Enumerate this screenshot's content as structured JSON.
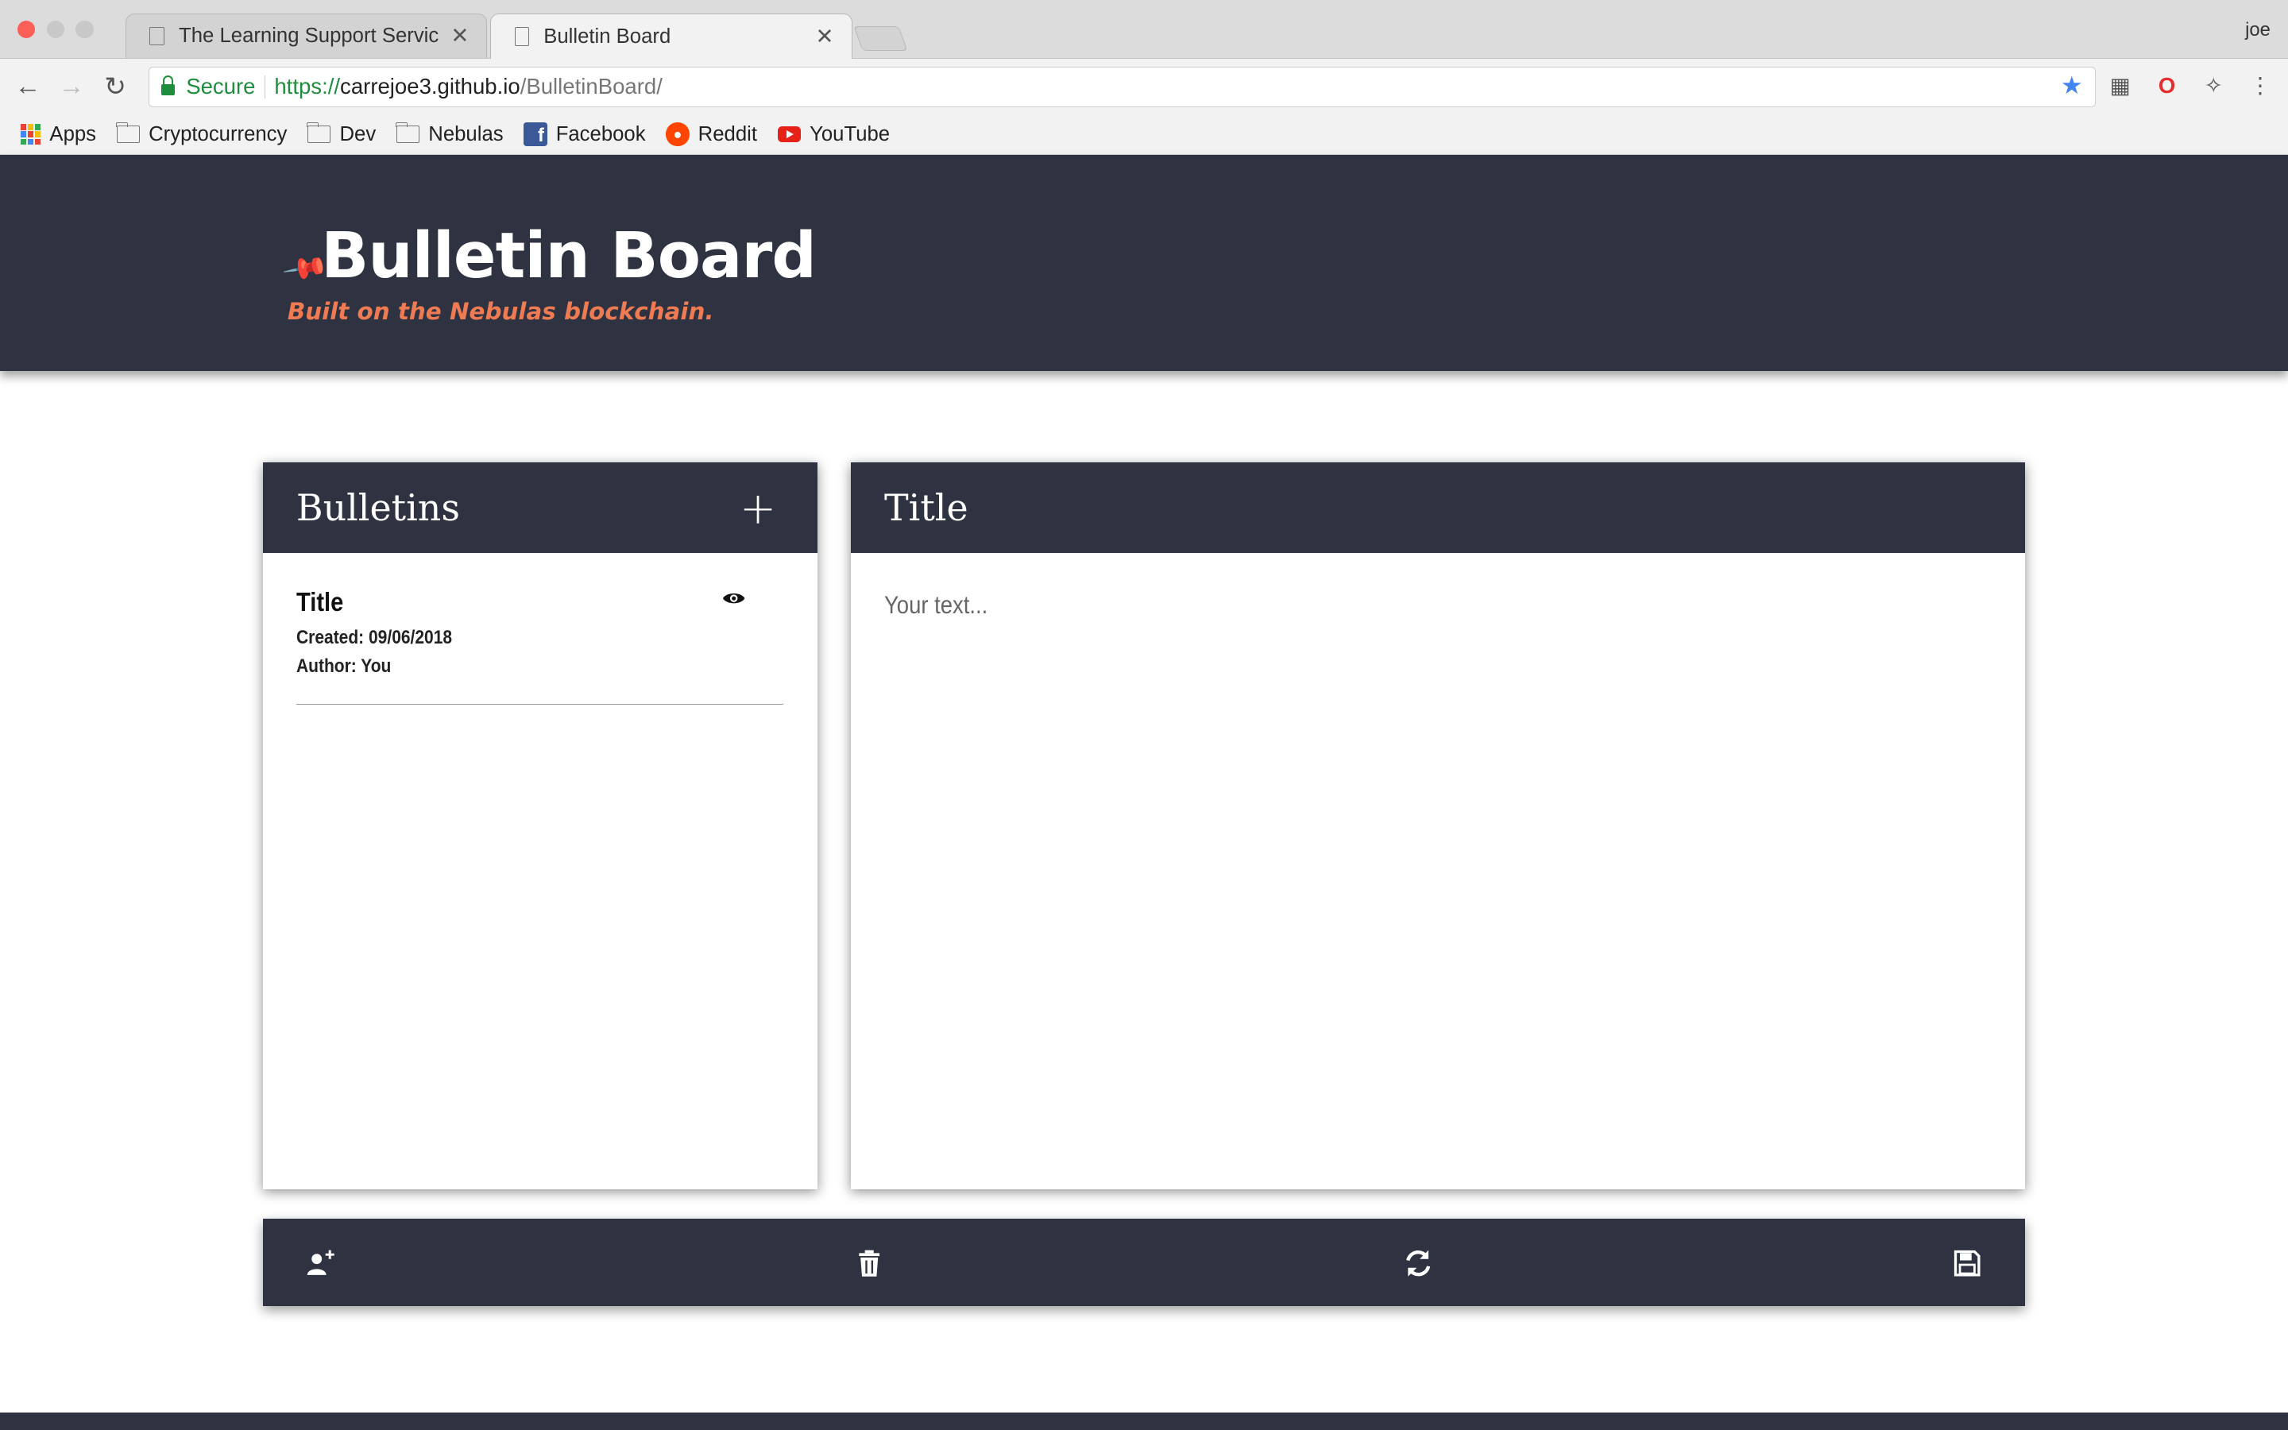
{
  "browser": {
    "tabs": [
      {
        "title": "The Learning Support Service"
      },
      {
        "title": "Bulletin Board"
      }
    ],
    "profile": "joe",
    "address": {
      "secure_label": "Secure",
      "scheme": "https://",
      "host": "carrejoe3.github.io",
      "path": "/BulletinBoard/"
    },
    "bookmarks": [
      "Apps",
      "Cryptocurrency",
      "Dev",
      "Nebulas",
      "Facebook",
      "Reddit",
      "YouTube"
    ]
  },
  "hero": {
    "title": "Bulletin Board",
    "subtitle": "Built on the Nebulas blockchain."
  },
  "bulletins_panel": {
    "heading": "Bulletins",
    "items": [
      {
        "title": "Title",
        "created": "Created: 09/06/2018",
        "author": "Author: You"
      }
    ]
  },
  "editor_panel": {
    "title": "Title",
    "placeholder": "Your text..."
  },
  "colors": {
    "header_bg": "#2e3241",
    "accent": "#ef7b52"
  }
}
